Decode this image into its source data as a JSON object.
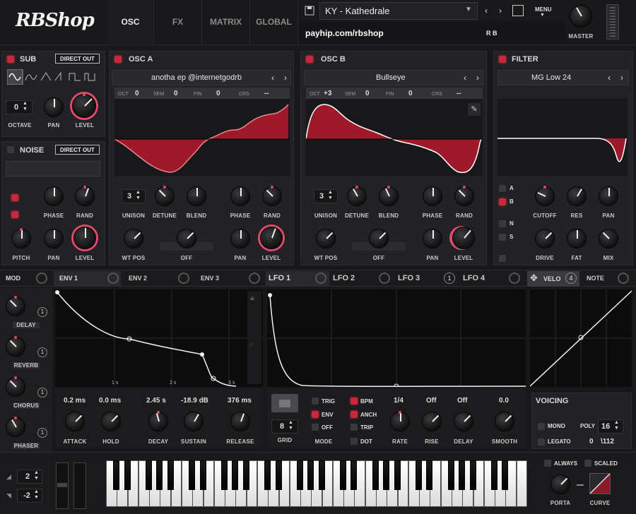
{
  "logo": "RBShop",
  "tabs": [
    "OSC",
    "FX",
    "MATRIX",
    "GLOBAL"
  ],
  "preset": {
    "name": "KY - Kathedrale",
    "url": "payhip.com/rbshop",
    "tag": "R B",
    "menu": "MENU"
  },
  "master": "MASTER",
  "sub": {
    "title": "SUB",
    "direct": "DIRECT OUT",
    "octave": "0",
    "labels": [
      "OCTAVE",
      "PAN",
      "LEVEL"
    ]
  },
  "noise": {
    "title": "NOISE",
    "direct": "DIRECT OUT",
    "labels": [
      "PHASE",
      "RAND",
      "PITCH",
      "PAN",
      "LEVEL"
    ]
  },
  "osca": {
    "title": "OSC A",
    "wt": "anotha ep @internetgodrb",
    "oct": "OCT",
    "oct_v": "0",
    "sem": "SEM",
    "sem_v": "0",
    "fin": "FIN",
    "fin_v": "0",
    "crs": "CRS",
    "crs_v": "--",
    "unison": "3",
    "labels": [
      "UNISON",
      "DETUNE",
      "BLEND",
      "PHASE",
      "RAND",
      "WT POS",
      "PAN",
      "LEVEL"
    ],
    "off": "OFF"
  },
  "oscb": {
    "title": "OSC B",
    "wt": "Bullseye",
    "oct": "OCT",
    "oct_v": "+3",
    "sem": "SEM",
    "sem_v": "0",
    "fin": "FIN",
    "fin_v": "0",
    "crs": "CRS",
    "crs_v": "--",
    "unison": "3",
    "labels": [
      "UNISON",
      "DETUNE",
      "BLEND",
      "PHASE",
      "RAND",
      "WT POS",
      "PAN",
      "LEVEL"
    ],
    "off": "OFF"
  },
  "filter": {
    "title": "FILTER",
    "type": "MG Low 24",
    "routes": [
      "A",
      "B",
      "N",
      "S"
    ],
    "labels": [
      "CUTOFF",
      "RES",
      "PAN",
      "DRIVE",
      "FAT",
      "MIX"
    ]
  },
  "mod": {
    "mod": "MOD",
    "envs": [
      "ENV 1",
      "ENV 2",
      "ENV 3"
    ],
    "lfos": [
      "LFO 1",
      "LFO 2",
      "LFO 3",
      "LFO 4"
    ],
    "lfo3_count": "1",
    "velo": "VELO",
    "velo_count": "4",
    "note": "NOTE"
  },
  "fx": [
    {
      "name": "DELAY",
      "count": "1"
    },
    {
      "name": "REVERB",
      "count": "1"
    },
    {
      "name": "CHORUS",
      "count": "1"
    },
    {
      "name": "PHASER",
      "count": "1"
    }
  ],
  "env": {
    "ticks": [
      "1 s",
      "2 s",
      "3 s"
    ],
    "values": [
      "0.2 ms",
      "0.0 ms",
      "2.45 s",
      "-18.9 dB",
      "376 ms"
    ],
    "labels": [
      "ATTACK",
      "HOLD",
      "DECAY",
      "SUSTAIN",
      "RELEASE"
    ]
  },
  "lfo": {
    "grid": "8",
    "grid_label": "GRID",
    "modes": [
      "TRIG",
      "ENV",
      "OFF"
    ],
    "mode_label": "MODE",
    "opts": [
      "BPM",
      "ANCH",
      "TRIP",
      "DOT"
    ],
    "values": [
      "1/4",
      "Off",
      "Off",
      "0.0"
    ],
    "labels": [
      "RATE",
      "RISE",
      "DELAY",
      "SMOOTH"
    ]
  },
  "voicing": {
    "title": "VOICING",
    "mono": "MONO",
    "poly": "POLY",
    "poly_v": "16",
    "legato": "LEGATO",
    "count": "0",
    "max": "\\112"
  },
  "bottom": {
    "pitch_up": "2",
    "pitch_down": "-2",
    "always": "ALWAYS",
    "scaled": "SCALED",
    "porta": "PORTA",
    "curve": "CURVE"
  },
  "colors": {
    "accent": "#c9283a",
    "bg": "#18181a"
  }
}
